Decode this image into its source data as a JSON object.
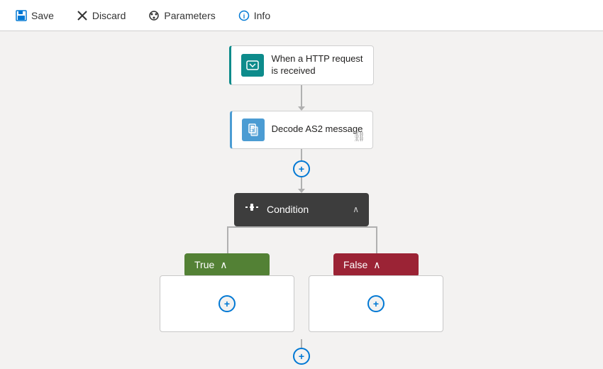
{
  "toolbar": {
    "save_label": "Save",
    "discard_label": "Discard",
    "parameters_label": "Parameters",
    "info_label": "Info"
  },
  "canvas": {
    "nodes": {
      "http_request": {
        "label": "When a HTTP request\nis received",
        "icon_type": "teal"
      },
      "decode": {
        "label": "Decode AS2 message",
        "icon_type": "blue"
      },
      "condition": {
        "label": "Condition"
      },
      "branch_true": {
        "label": "True"
      },
      "branch_false": {
        "label": "False"
      }
    }
  }
}
